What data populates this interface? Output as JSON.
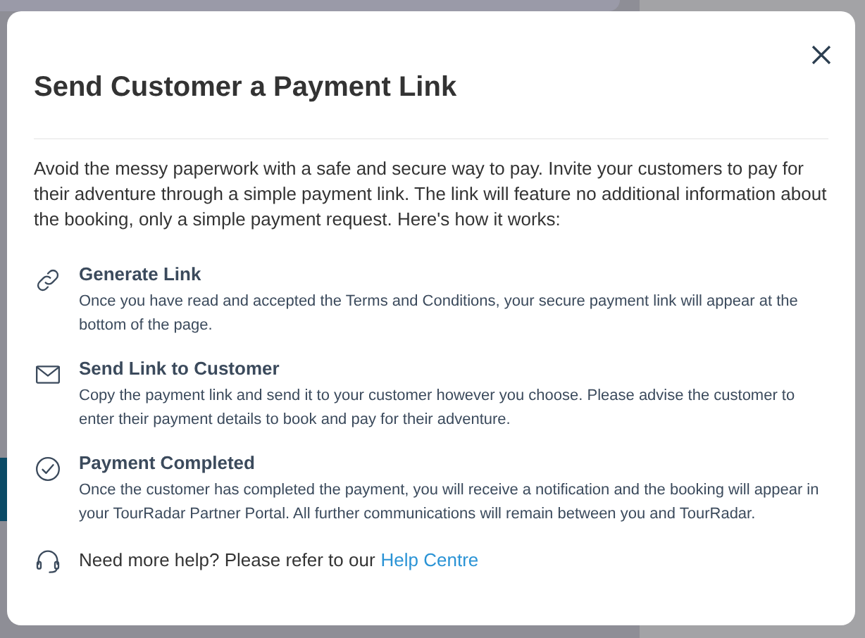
{
  "dialog": {
    "title": "Send Customer a Payment Link",
    "intro": "Avoid the messy paperwork with a safe and secure way to pay. Invite your customers to pay for their adventure through a simple payment link. The link will feature no additional information about the booking, only a simple payment request. Here's how it works:",
    "steps": [
      {
        "kind": "link",
        "title": "Generate Link",
        "text": "Once you have read and accepted the Terms and Conditions, your secure payment link will appear at the bottom of the page."
      },
      {
        "kind": "envelope",
        "title": "Send Link to Customer",
        "text": "Copy the payment link and send it to your customer however you choose. Please advise the customer to enter their payment details to book and pay for their adventure."
      },
      {
        "kind": "check",
        "title": "Payment Completed",
        "text": "Once the customer has completed the payment, you will receive a notification and the booking will appear in your TourRadar Partner Portal. All further communications will remain between you and TourRadar."
      }
    ],
    "help": {
      "text": "Need more help? Please refer to our",
      "link": "Help Centre"
    }
  }
}
